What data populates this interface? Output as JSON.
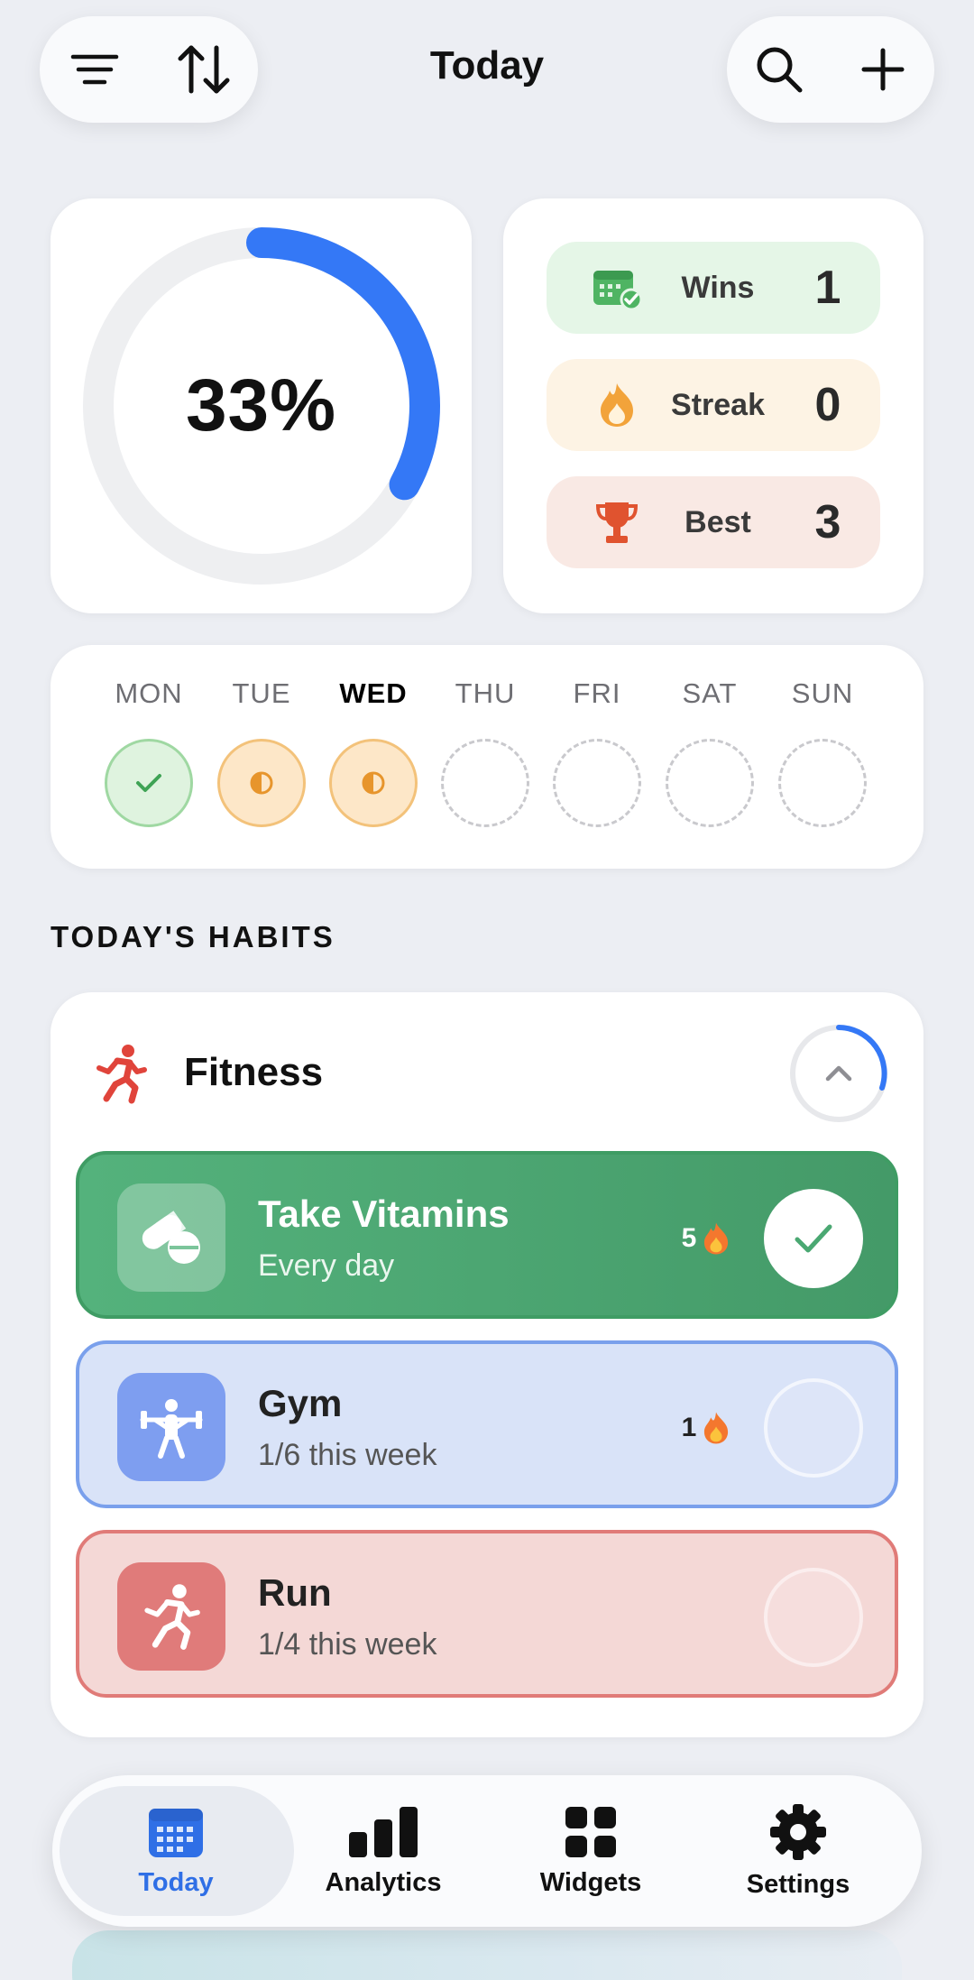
{
  "header": {
    "title": "Today",
    "left_icons": [
      "filter-icon",
      "sort-icon"
    ],
    "right_icons": [
      "search-icon",
      "plus-icon"
    ]
  },
  "progress": {
    "percent_label": "33%",
    "fraction": 0.33,
    "accent": "#3478f6"
  },
  "stats": [
    {
      "label": "Wins",
      "value": "1",
      "icon": "calendar-check-icon",
      "color": "#e5f6e7"
    },
    {
      "label": "Streak",
      "value": "0",
      "icon": "flame-icon",
      "color": "#fdf3e4"
    },
    {
      "label": "Best",
      "value": "3",
      "icon": "trophy-icon",
      "color": "#f9e9e4"
    }
  ],
  "week": {
    "days": [
      "MON",
      "TUE",
      "WED",
      "THU",
      "FRI",
      "SAT",
      "SUN"
    ],
    "active_day": "WED",
    "states": [
      "done",
      "partial",
      "partial",
      "empty",
      "empty",
      "empty",
      "empty"
    ]
  },
  "section_title": "TODAY'S HABITS",
  "group": {
    "title": "Fitness",
    "icon": "running-person-icon",
    "habits": [
      {
        "name": "Take Vitamins",
        "subtitle": "Every day",
        "streak": "5",
        "icon": "pill-icon",
        "completed": true,
        "color": "#54b27c"
      },
      {
        "name": "Gym",
        "subtitle": "1/6 this week",
        "streak": "1",
        "icon": "weightlifting-icon",
        "completed": false,
        "color": "#7e9ef0"
      },
      {
        "name": "Run",
        "subtitle": "1/4 this week",
        "icon": "running-icon",
        "completed": false,
        "color": "#e07b7a"
      }
    ]
  },
  "tabbar": {
    "tabs": [
      {
        "label": "Today",
        "icon": "calendar-icon",
        "active": true
      },
      {
        "label": "Analytics",
        "icon": "bar-chart-icon",
        "active": false
      },
      {
        "label": "Widgets",
        "icon": "grid-icon",
        "active": false
      },
      {
        "label": "Settings",
        "icon": "gear-icon",
        "active": false
      }
    ]
  }
}
